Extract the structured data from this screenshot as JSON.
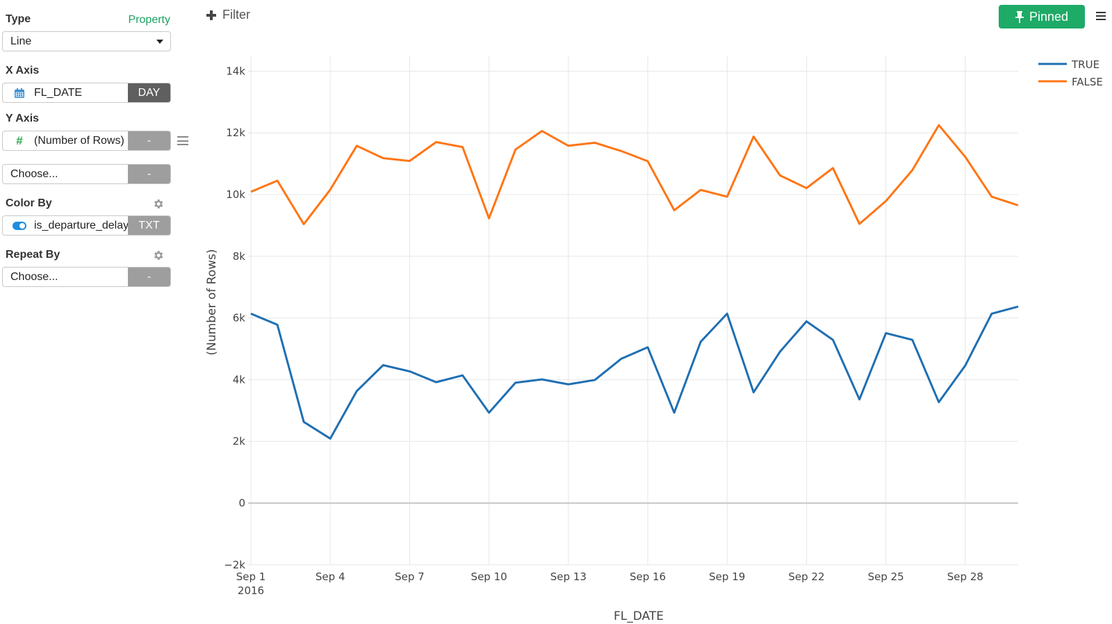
{
  "sidebar": {
    "type_label": "Type",
    "property_link": "Property",
    "type_value": "Line",
    "x_axis_label": "X Axis",
    "x_axis_field": "FL_DATE",
    "x_axis_unit": "DAY",
    "y_axis_label": "Y Axis",
    "y_axis_field": "(Number of Rows)",
    "y_axis_tag": "-",
    "y_axis_extra_placeholder": "Choose...",
    "y_axis_extra_tag": "-",
    "color_by_label": "Color By",
    "color_by_field": "is_departure_delayed",
    "color_by_tag": "TXT",
    "repeat_by_label": "Repeat By",
    "repeat_by_placeholder": "Choose...",
    "repeat_by_tag": "-"
  },
  "toolbar": {
    "filter_label": "Filter",
    "pinned_label": "Pinned",
    "accent_color": "#1eaa67"
  },
  "chart_data": {
    "type": "line",
    "title": "",
    "xlabel": "FL_DATE",
    "ylabel": "(Number of Rows)",
    "x": [
      "2016-09-01",
      "2016-09-02",
      "2016-09-03",
      "2016-09-04",
      "2016-09-05",
      "2016-09-06",
      "2016-09-07",
      "2016-09-08",
      "2016-09-09",
      "2016-09-10",
      "2016-09-11",
      "2016-09-12",
      "2016-09-13",
      "2016-09-14",
      "2016-09-15",
      "2016-09-16",
      "2016-09-17",
      "2016-09-18",
      "2016-09-19",
      "2016-09-20",
      "2016-09-21",
      "2016-09-22",
      "2016-09-23",
      "2016-09-24",
      "2016-09-25",
      "2016-09-26",
      "2016-09-27",
      "2016-09-28",
      "2016-09-29",
      "2016-09-30"
    ],
    "x_tick_labels": [
      {
        "day": 1,
        "label": "Sep 1",
        "sublabel": "2016"
      },
      {
        "day": 4,
        "label": "Sep 4"
      },
      {
        "day": 7,
        "label": "Sep 7"
      },
      {
        "day": 10,
        "label": "Sep 10"
      },
      {
        "day": 13,
        "label": "Sep 13"
      },
      {
        "day": 16,
        "label": "Sep 16"
      },
      {
        "day": 19,
        "label": "Sep 19"
      },
      {
        "day": 22,
        "label": "Sep 22"
      },
      {
        "day": 25,
        "label": "Sep 25"
      },
      {
        "day": 28,
        "label": "Sep 28"
      }
    ],
    "y_ticks": [
      {
        "value": -2000,
        "label": "−2k"
      },
      {
        "value": 0,
        "label": "0"
      },
      {
        "value": 2000,
        "label": "2k"
      },
      {
        "value": 4000,
        "label": "4k"
      },
      {
        "value": 6000,
        "label": "6k"
      },
      {
        "value": 8000,
        "label": "8k"
      },
      {
        "value": 10000,
        "label": "10k"
      },
      {
        "value": 12000,
        "label": "12k"
      },
      {
        "value": 14000,
        "label": "14k"
      }
    ],
    "ylim": [
      -2000,
      14500
    ],
    "xlim_days": [
      1,
      30
    ],
    "grid": true,
    "legend_position": "top-right",
    "series": [
      {
        "name": "TRUE",
        "color": "#1f6fb2",
        "values": [
          6140,
          5780,
          2630,
          2090,
          3630,
          4470,
          4270,
          3920,
          4140,
          2930,
          3900,
          4010,
          3850,
          3990,
          4680,
          5050,
          2930,
          5230,
          6140,
          3590,
          4910,
          5890,
          5290,
          3360,
          5510,
          5290,
          3270,
          4460,
          6140,
          6370
        ]
      },
      {
        "name": "FALSE",
        "color": "#ff7514",
        "values": [
          10090,
          10450,
          9040,
          10160,
          11580,
          11180,
          11090,
          11700,
          11540,
          9230,
          11460,
          12060,
          11580,
          11680,
          11410,
          11080,
          9490,
          10150,
          9930,
          11880,
          10620,
          10210,
          10860,
          9050,
          9790,
          10790,
          12250,
          11220,
          9930,
          9650
        ]
      }
    ]
  }
}
